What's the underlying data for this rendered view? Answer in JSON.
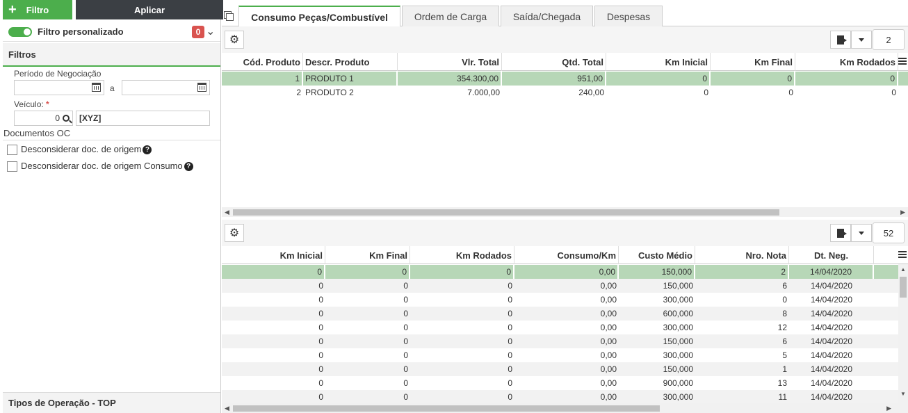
{
  "left": {
    "filtro_label": "Filtro",
    "aplicar_label": "Aplicar",
    "custom_filter_label": "Filtro personalizado",
    "custom_filter_count": "0",
    "filtros_title": "Filtros",
    "periodo_label": "Período de Negociação",
    "periodo_sep": "a",
    "veiculo_label": "Veículo:",
    "veiculo_required": "*",
    "veiculo_code": "0",
    "veiculo_name": "[XYZ]",
    "documentos_label": "Documentos OC",
    "checkbox1_label": "Desconsiderar doc. de origem",
    "checkbox2_label": "Desconsiderar doc. de origem Consumo",
    "tipos_title": "Tipos de Operação - TOP"
  },
  "tabs": [
    {
      "label": "Consumo Peças/Combustível"
    },
    {
      "label": "Ordem de Carga"
    },
    {
      "label": "Saída/Chegada"
    },
    {
      "label": "Despesas"
    }
  ],
  "grid1": {
    "count": "2",
    "headers": [
      "Cód. Produto",
      "Descr. Produto",
      "Vlr. Total",
      "Qtd. Total",
      "Km Inicial",
      "Km Final",
      "Km Rodados"
    ],
    "rows": [
      [
        "1",
        "PRODUTO 1",
        "354.300,00",
        "951,00",
        "0",
        "0",
        "0"
      ],
      [
        "2",
        "PRODUTO 2",
        "7.000,00",
        "240,00",
        "0",
        "0",
        "0"
      ]
    ]
  },
  "grid2": {
    "count": "52",
    "headers": [
      "Km Inicial",
      "Km Final",
      "Km Rodados",
      "Consumo/Km",
      "Custo Médio",
      "Nro. Nota",
      "Dt. Neg."
    ],
    "rows": [
      [
        "0",
        "0",
        "0",
        "0,00",
        "150,000",
        "2",
        "14/04/2020"
      ],
      [
        "0",
        "0",
        "0",
        "0,00",
        "150,000",
        "6",
        "14/04/2020"
      ],
      [
        "0",
        "0",
        "0",
        "0,00",
        "300,000",
        "0",
        "14/04/2020"
      ],
      [
        "0",
        "0",
        "0",
        "0,00",
        "600,000",
        "8",
        "14/04/2020"
      ],
      [
        "0",
        "0",
        "0",
        "0,00",
        "300,000",
        "12",
        "14/04/2020"
      ],
      [
        "0",
        "0",
        "0",
        "0,00",
        "150,000",
        "6",
        "14/04/2020"
      ],
      [
        "0",
        "0",
        "0",
        "0,00",
        "300,000",
        "5",
        "14/04/2020"
      ],
      [
        "0",
        "0",
        "0",
        "0,00",
        "150,000",
        "1",
        "14/04/2020"
      ],
      [
        "0",
        "0",
        "0",
        "0,00",
        "900,000",
        "13",
        "14/04/2020"
      ],
      [
        "0",
        "0",
        "0",
        "0,00",
        "300,000",
        "11",
        "14/04/2020"
      ]
    ]
  },
  "colors": {
    "accent": "#4cae4c",
    "selected_row": "#b7d7b7",
    "badge": "#d9534f",
    "dark_button": "#3b3f44"
  }
}
